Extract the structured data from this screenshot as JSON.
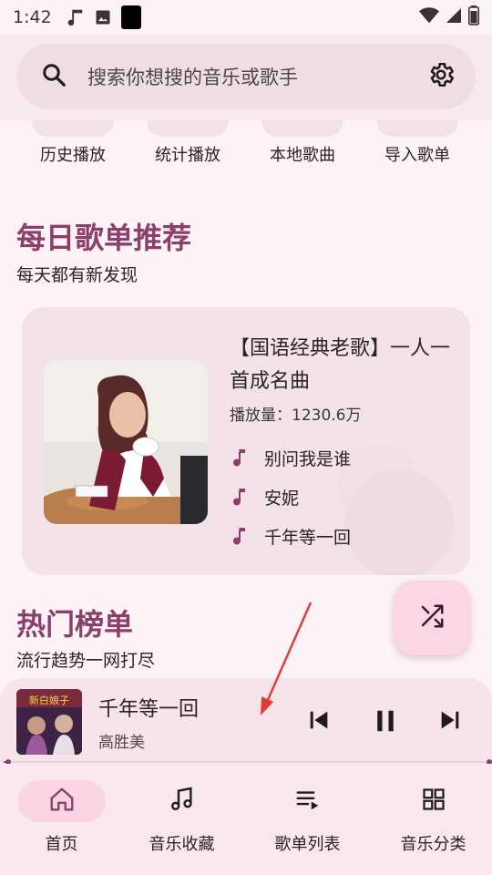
{
  "status_bar": {
    "time": "1:42"
  },
  "search": {
    "placeholder": "搜索你想搜的音乐或歌手"
  },
  "quick_actions": [
    {
      "label": "历史播放"
    },
    {
      "label": "统计播放"
    },
    {
      "label": "本地歌曲"
    },
    {
      "label": "导入歌单"
    }
  ],
  "daily": {
    "title": "每日歌单推荐",
    "subtitle": "每天都有新发现",
    "card": {
      "playlist_name": "【国语经典老歌】一人一首成名曲",
      "plays": "播放量：1230.6万",
      "songs": [
        "别问我是谁",
        "安妮",
        "千年等一回"
      ]
    }
  },
  "hot": {
    "title": "热门榜单",
    "subtitle": "流行趋势一网打尽"
  },
  "player": {
    "title": "千年等一回",
    "artist": "高胜美",
    "progress": 0.01
  },
  "nav": [
    {
      "label": "首页",
      "icon": "home-icon",
      "active": true
    },
    {
      "label": "音乐收藏",
      "icon": "music-note-icon",
      "active": false
    },
    {
      "label": "歌单列表",
      "icon": "playlist-icon",
      "active": false
    },
    {
      "label": "音乐分类",
      "icon": "grid-icon",
      "active": false
    }
  ],
  "colors": {
    "accent": "#8b3f6a",
    "background": "#fdf3f6",
    "fab": "#fbd7e6",
    "arrow": "#e53935"
  }
}
